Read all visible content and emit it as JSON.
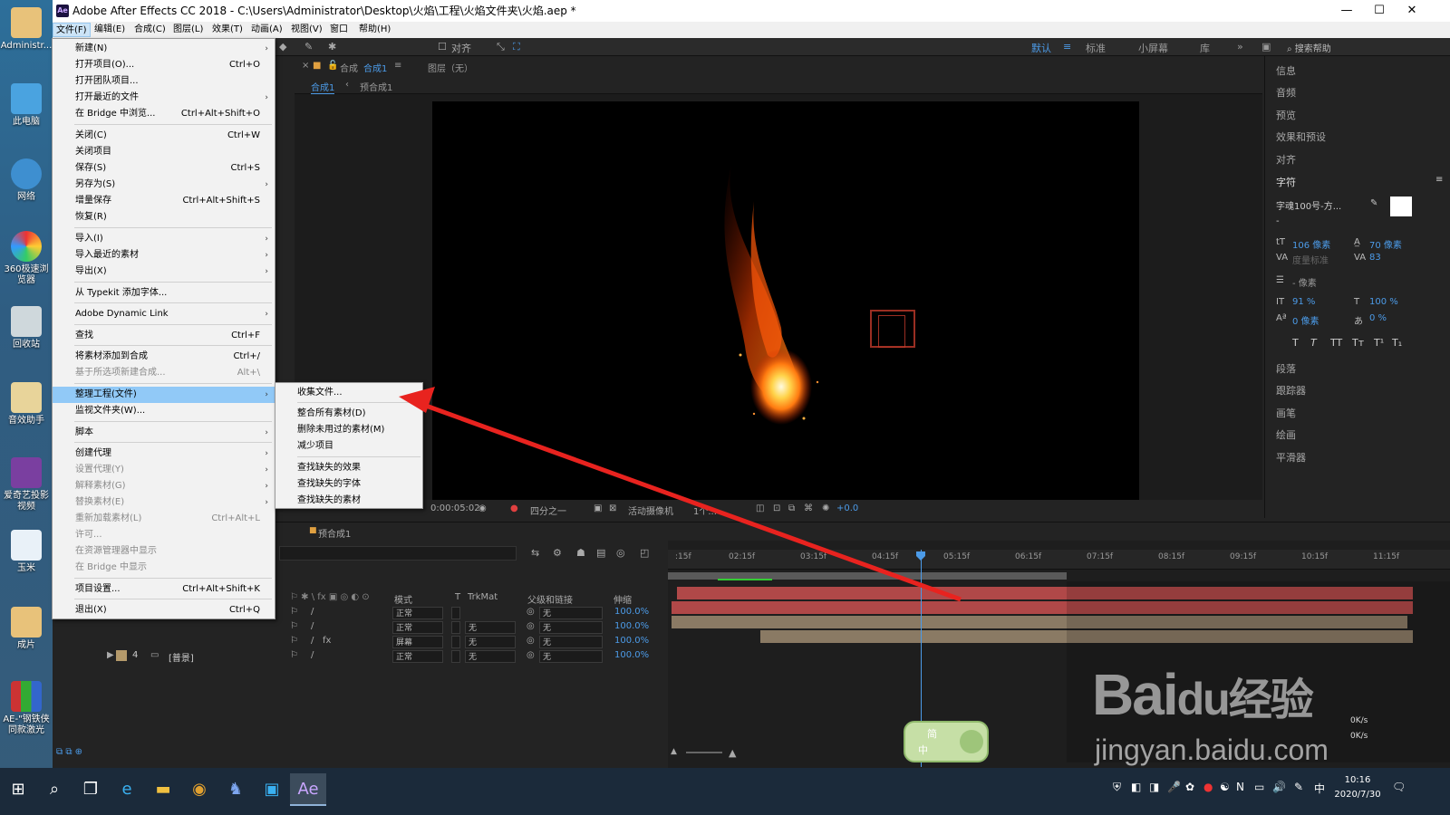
{
  "desktop": {
    "icons": [
      "Administr...",
      "此电脑",
      "网络",
      "360极速浏览器",
      "回收站",
      "音效助手",
      "爱奇艺投影视频",
      "玉米",
      "成片",
      "AE-\"钢铁侠同款激光",
      "AE-\"钢铁侠同款激光光"
    ]
  },
  "window": {
    "title": "Adobe After Effects CC 2018 - C:\\Users\\Administrator\\Desktop\\火焰\\工程\\火焰文件夹\\火焰.aep *",
    "logo": "Ae",
    "minimize": "—",
    "maximize": "☐",
    "close": "✕"
  },
  "menubar": [
    "文件(F)",
    "编辑(E)",
    "合成(C)",
    "图层(L)",
    "效果(T)",
    "动画(A)",
    "视图(V)",
    "窗口",
    "帮助(H)"
  ],
  "toolbar": {
    "snap_label": "对齐",
    "workspaces": [
      "默认",
      "标准",
      "小屏幕",
      "库"
    ],
    "search_placeholder": "搜索帮助"
  },
  "comp": {
    "tab_prefix": "合成",
    "tab_name": "合成1",
    "layer_tab": "图层（无）",
    "subtabs": [
      "合成1",
      "预合成1"
    ],
    "timecode": "0:00:05:02",
    "zoom": "四分之一",
    "camera": "活动摄像机",
    "views": "1个...",
    "exposure": "+0.0"
  },
  "right_panel": {
    "items": [
      "信息",
      "音频",
      "预览",
      "效果和预设",
      "对齐",
      "字符"
    ],
    "font_name": "字魂100号-方...",
    "font_style": "-",
    "font_size": "106 像素",
    "leading": "70 像素",
    "kerning": "度量标准",
    "tracking": "83",
    "stroke": "- 像素",
    "v_scale": "91 %",
    "h_scale": "100 %",
    "baseline": "0 像素",
    "tsume": "0 %",
    "styles": [
      "T",
      "T",
      "TT",
      "Tт",
      "T¹",
      "T₁"
    ],
    "items2": [
      "段落",
      "跟踪器",
      "画笔",
      "绘画",
      "平滑器"
    ]
  },
  "timeline": {
    "tab": "预合成1",
    "headers": [
      "模式",
      "T",
      "TrkMat",
      "父级和链接",
      "伸缩"
    ],
    "rows": [
      {
        "mode": "正常",
        "trkmat": "",
        "parent": "无",
        "stretch": "100.0%"
      },
      {
        "mode": "正常",
        "trkmat": "无",
        "parent": "无",
        "stretch": "100.0%"
      },
      {
        "mode": "屏幕",
        "trkmat": "无",
        "parent": "无",
        "stretch": "100.0%"
      },
      {
        "mode": "正常",
        "trkmat": "无",
        "parent": "无",
        "stretch": "100.0%",
        "index": "4",
        "name": "[普景]"
      }
    ],
    "ticks": [
      ":15f",
      "02:15f",
      "03:15f",
      "04:15f",
      "05:15f",
      "06:15f",
      "07:15f",
      "08:15f",
      "09:15f",
      "10:15f",
      "11:15f"
    ]
  },
  "file_menu": [
    {
      "label": "新建(N)",
      "shortcut": "",
      "arrow": "›"
    },
    {
      "label": "打开项目(O)...",
      "shortcut": "Ctrl+O"
    },
    {
      "label": "打开团队项目...",
      "shortcut": ""
    },
    {
      "label": "打开最近的文件",
      "shortcut": "",
      "arrow": "›"
    },
    {
      "label": "在 Bridge 中浏览...",
      "shortcut": "Ctrl+Alt+Shift+O"
    },
    {
      "label": "关闭(C)",
      "shortcut": "Ctrl+W"
    },
    {
      "label": "关闭项目",
      "shortcut": ""
    },
    {
      "label": "保存(S)",
      "shortcut": "Ctrl+S"
    },
    {
      "label": "另存为(S)",
      "shortcut": "",
      "arrow": "›"
    },
    {
      "label": "增量保存",
      "shortcut": "Ctrl+Alt+Shift+S"
    },
    {
      "label": "恢复(R)",
      "shortcut": ""
    },
    {
      "label": "导入(I)",
      "shortcut": "",
      "arrow": "›"
    },
    {
      "label": "导入最近的素材",
      "shortcut": "",
      "arrow": "›"
    },
    {
      "label": "导出(X)",
      "shortcut": "",
      "arrow": "›"
    },
    {
      "label": "从 Typekit 添加字体...",
      "shortcut": ""
    },
    {
      "label": "Adobe Dynamic Link",
      "shortcut": "",
      "arrow": "›"
    },
    {
      "label": "查找",
      "shortcut": "Ctrl+F"
    },
    {
      "label": "将素材添加到合成",
      "shortcut": "Ctrl+/"
    },
    {
      "label": "基于所选项新建合成...",
      "shortcut": "Alt+\\"
    },
    {
      "label": "整理工程(文件)",
      "shortcut": "",
      "arrow": "›"
    },
    {
      "label": "监视文件夹(W)...",
      "shortcut": ""
    },
    {
      "label": "脚本",
      "shortcut": "",
      "arrow": "›"
    },
    {
      "label": "创建代理",
      "shortcut": "",
      "arrow": "›"
    },
    {
      "label": "设置代理(Y)",
      "shortcut": "",
      "arrow": "›"
    },
    {
      "label": "解释素材(G)",
      "shortcut": "",
      "arrow": "›"
    },
    {
      "label": "替换素材(E)",
      "shortcut": "",
      "arrow": "›"
    },
    {
      "label": "重新加载素材(L)",
      "shortcut": "Ctrl+Alt+L"
    },
    {
      "label": "许可...",
      "shortcut": ""
    },
    {
      "label": "在资源管理器中显示",
      "shortcut": ""
    },
    {
      "label": "在 Bridge 中显示",
      "shortcut": ""
    },
    {
      "label": "项目设置...",
      "shortcut": "Ctrl+Alt+Shift+K"
    },
    {
      "label": "退出(X)",
      "shortcut": "Ctrl+Q"
    }
  ],
  "sub_menu": [
    "收集文件...",
    "整合所有素材(D)",
    "删除未用过的素材(M)",
    "减少项目",
    "查找缺失的效果",
    "查找缺失的字体",
    "查找缺失的素材"
  ],
  "watermark": {
    "line1": "Bai",
    "paw": "du",
    "line1b": "经验",
    "line2": "jingyan.baidu.com"
  },
  "ime": {
    "top": "简",
    "left": "中"
  },
  "netspeed": [
    "0K/s",
    "0K/s"
  ],
  "taskbar": {
    "time": "10:16",
    "date": "2020/7/30",
    "ime_tray": "中"
  }
}
